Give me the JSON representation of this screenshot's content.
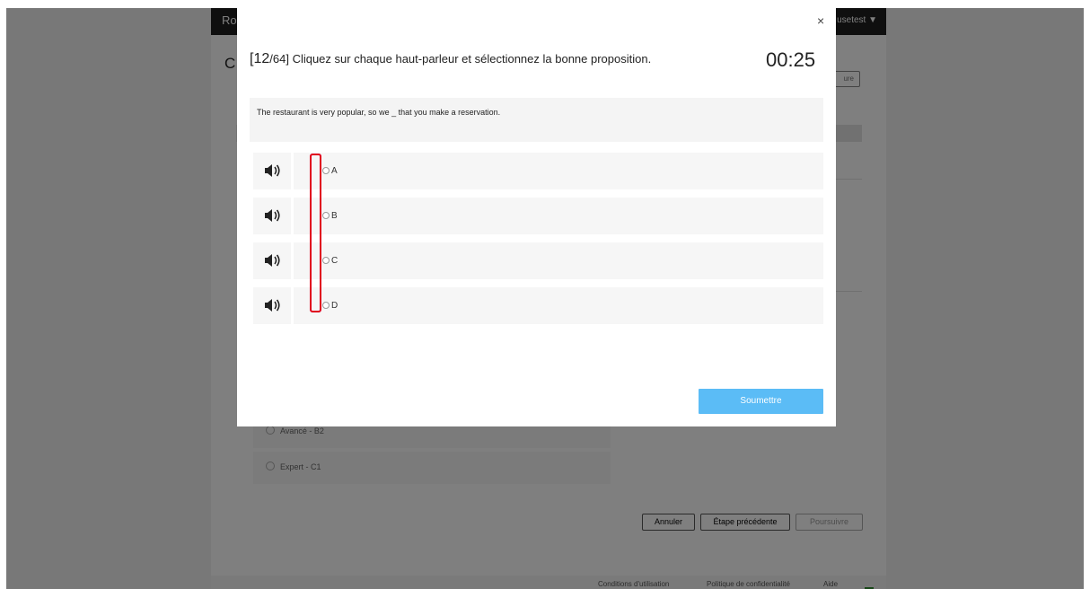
{
  "background": {
    "brand": "Ro",
    "user_menu": "usetest ▼",
    "title_fragment": "C",
    "top_button": "ure",
    "levels": [
      {
        "label": "Avancé - B2"
      },
      {
        "label": "Expert - C1"
      }
    ],
    "buttons": {
      "cancel": "Annuler",
      "previous": "Étape précédente",
      "continue": "Poursuivre"
    },
    "footer": {
      "terms": "Conditions d'utilisation",
      "privacy": "Politique de confidentialité",
      "help": "Aide"
    }
  },
  "modal": {
    "close_symbol": "×",
    "question_number": "[12",
    "question_total": "/64]",
    "instruction": "Cliquez sur chaque haut-parleur et sélectionnez la bonne proposition.",
    "timer": "00:25",
    "sentence": "The restaurant is very popular, so we _ that you make a reservation.",
    "options": [
      {
        "label": "A",
        "icon": "speaker-icon"
      },
      {
        "label": "B",
        "icon": "speaker-icon"
      },
      {
        "label": "C",
        "icon": "speaker-icon"
      },
      {
        "label": "D",
        "icon": "speaker-icon"
      }
    ],
    "submit_label": "Soumettre"
  },
  "colors": {
    "submit": "#5bbcf6",
    "highlight": "#e0001e",
    "overlay": "rgba(0,0,0,0.5)",
    "topbar": "#1f1f1f"
  }
}
